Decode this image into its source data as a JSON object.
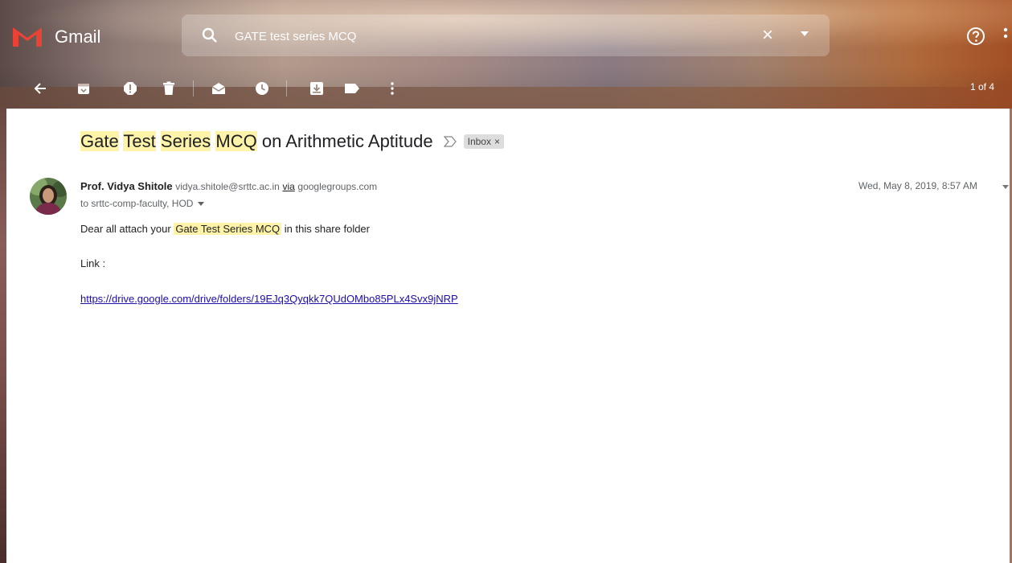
{
  "app": {
    "name": "Gmail"
  },
  "search": {
    "query": "GATE test series MCQ",
    "clear_label": "×"
  },
  "toolbar": {
    "page_count": "1 of 4"
  },
  "email": {
    "subject_parts": [
      {
        "text": "Gate",
        "highlight": true
      },
      {
        "text": " ",
        "highlight": false
      },
      {
        "text": "Test",
        "highlight": true
      },
      {
        "text": " ",
        "highlight": false
      },
      {
        "text": "Series",
        "highlight": true
      },
      {
        "text": " ",
        "highlight": false
      },
      {
        "text": "MCQ",
        "highlight": true
      },
      {
        "text": " on Arithmetic Aptitude",
        "highlight": false
      }
    ],
    "label": "Inbox",
    "label_close": "×",
    "sender_name": "Prof. Vidya Shitole",
    "sender_email": "vidya.shitole@srttc.ac.in",
    "via_word": "via",
    "via_domain": "googlegroups.com",
    "recipients": "to srttc-comp-faculty, HOD",
    "date": "Wed, May 8, 2019, 8:57 AM",
    "body": {
      "line1_before": "Dear all attach your ",
      "line1_highlight": "Gate Test Series MCQ",
      "line1_after": " in this share folder",
      "line2": "Link :",
      "link": "https://drive.google.com/drive/folders/19EJq3Qyqkk7QUdOMbo85PLx4Svx9jNRP"
    }
  },
  "colors": {
    "highlight": "#fef3a8",
    "link": "#1a0dab",
    "gmail_red": "#EA4335"
  }
}
